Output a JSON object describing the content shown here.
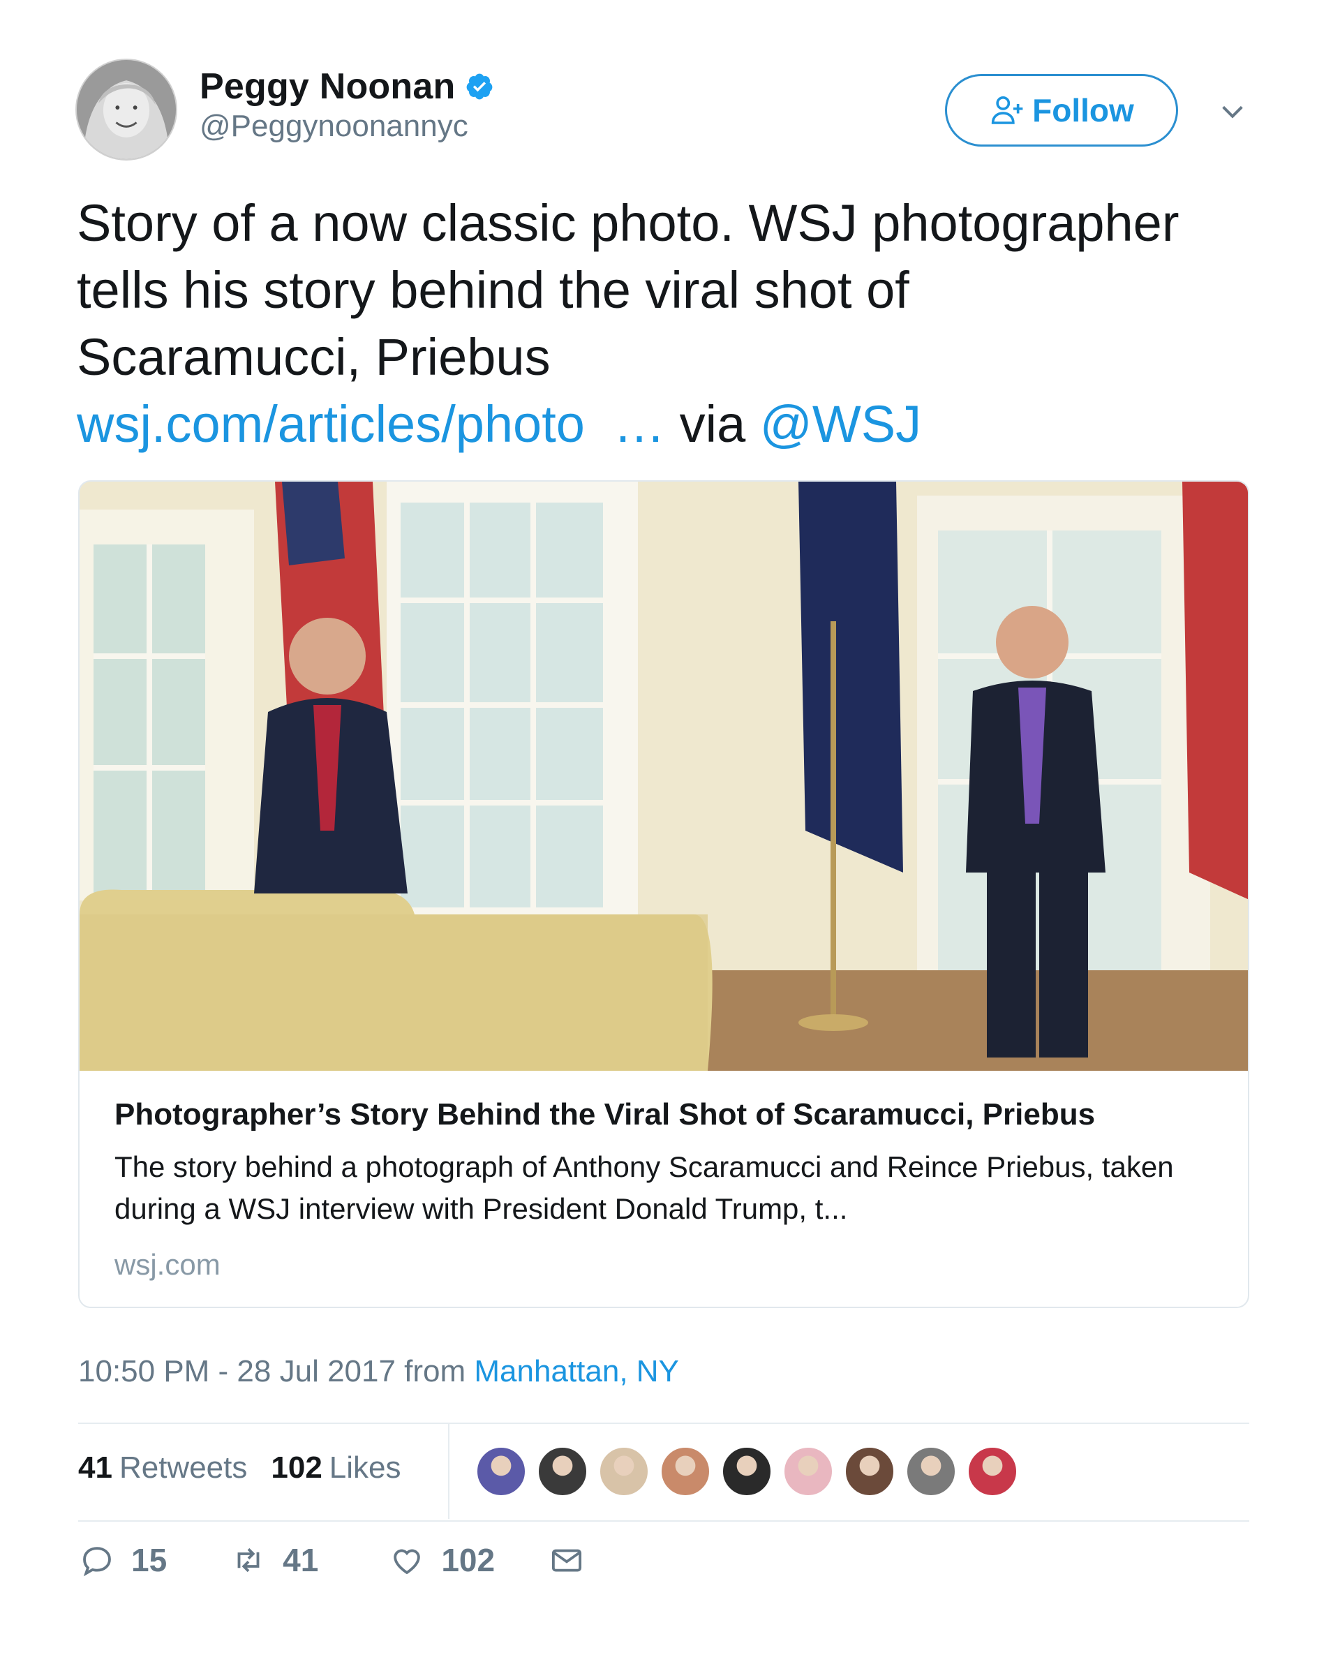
{
  "author": {
    "name": "Peggy Noonan",
    "handle": "@Peggynoonannyc",
    "verified": true
  },
  "follow": {
    "label": "Follow"
  },
  "tweet": {
    "text_before_link": "Story of a now classic photo. WSJ photographer tells his story behind the viral shot of Scaramucci, Priebus ",
    "link_text": "wsj.com/articles/photo  …",
    "via_text": " via ",
    "mention": "@WSJ"
  },
  "card": {
    "title": "Photographer’s Story Behind the Viral Shot of Scaramucci, Priebus",
    "description": "The story behind a photograph of Anthony Scaramucci and Reince Priebus, taken during a WSJ interview with President Donald Trump, t...",
    "domain": "wsj.com"
  },
  "meta": {
    "time": "10:50 PM - 28 Jul 2017",
    "from": " from ",
    "location": "Manhattan, NY"
  },
  "stats": {
    "retweets_count": "41",
    "retweets_label": "Retweets",
    "likes_count": "102",
    "likes_label": "Likes"
  },
  "likers": [
    "#5b5aa8",
    "#3a3a3a",
    "#d8c3a8",
    "#c98a6a",
    "#2a2a2a",
    "#e9b7c0",
    "#6b4a3a",
    "#7a7a7a",
    "#c8384a"
  ],
  "actions": {
    "reply_count": "15",
    "retweet_count": "41",
    "like_count": "102"
  },
  "colors": {
    "link": "#1b95e0",
    "muted": "#657786",
    "verified": "#1da1f2"
  },
  "icons": [
    "verified-badge-icon",
    "add-user-icon",
    "chevron-down-icon",
    "reply-icon",
    "retweet-icon",
    "heart-icon",
    "mail-icon"
  ]
}
